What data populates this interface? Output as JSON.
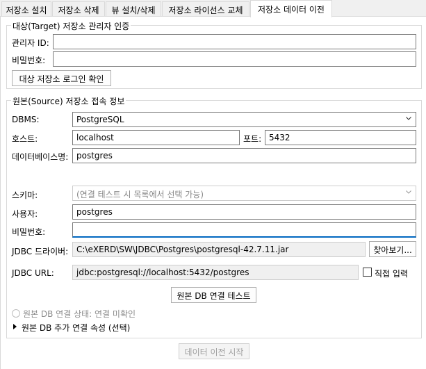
{
  "tabs": [
    {
      "label": "저장소 설치"
    },
    {
      "label": "저장소 삭제"
    },
    {
      "label": "뷰 설치/삭제"
    },
    {
      "label": "저장소 라이선스 교체"
    },
    {
      "label": "저장소 데이터 이전",
      "active": true
    }
  ],
  "target": {
    "legend": "대상(Target) 저장소 관리자 인증",
    "admin_id_label": "관리자 ID:",
    "admin_id_value": "",
    "password_label": "비밀번호:",
    "password_value": "",
    "login_button": "대상 저장소 로그인 확인"
  },
  "source": {
    "legend": "원본(Source) 저장소 접속 정보",
    "dbms_label": "DBMS:",
    "dbms_value": "PostgreSQL",
    "host_label": "호스트:",
    "host_value": "localhost",
    "port_label": "포트:",
    "port_value": "5432",
    "dbname_label": "데이터베이스명:",
    "dbname_value": "postgres",
    "schema_label": "스키마:",
    "schema_placeholder": "(연결 테스트 시 목록에서 선택 가능)",
    "user_label": "사용자:",
    "user_value": "postgres",
    "password_label": "비밀번호:",
    "password_value": "",
    "driver_label": "JDBC 드라이버:",
    "driver_value": "C:\\eXERD\\SW\\JDBC\\Postgres\\postgresql-42.7.11.jar",
    "browse_button": "찾아보기...",
    "url_label": "JDBC URL:",
    "url_value": "jdbc:postgresql://localhost:5432/postgres",
    "direct_input_label": "직접 입력",
    "direct_input_checked": false,
    "test_button": "원본 DB 연결 테스트",
    "status_text": "원본 DB 연결 상태: 연결 미확인",
    "advanced_label": "원본 DB 추가 연결 속성 (선택)"
  },
  "footer": {
    "start_button": "데이터 이전 시작"
  },
  "colors": {
    "focus_accent": "#0067c0",
    "border": "#7a7a7a",
    "background": "#f0f0f0"
  }
}
